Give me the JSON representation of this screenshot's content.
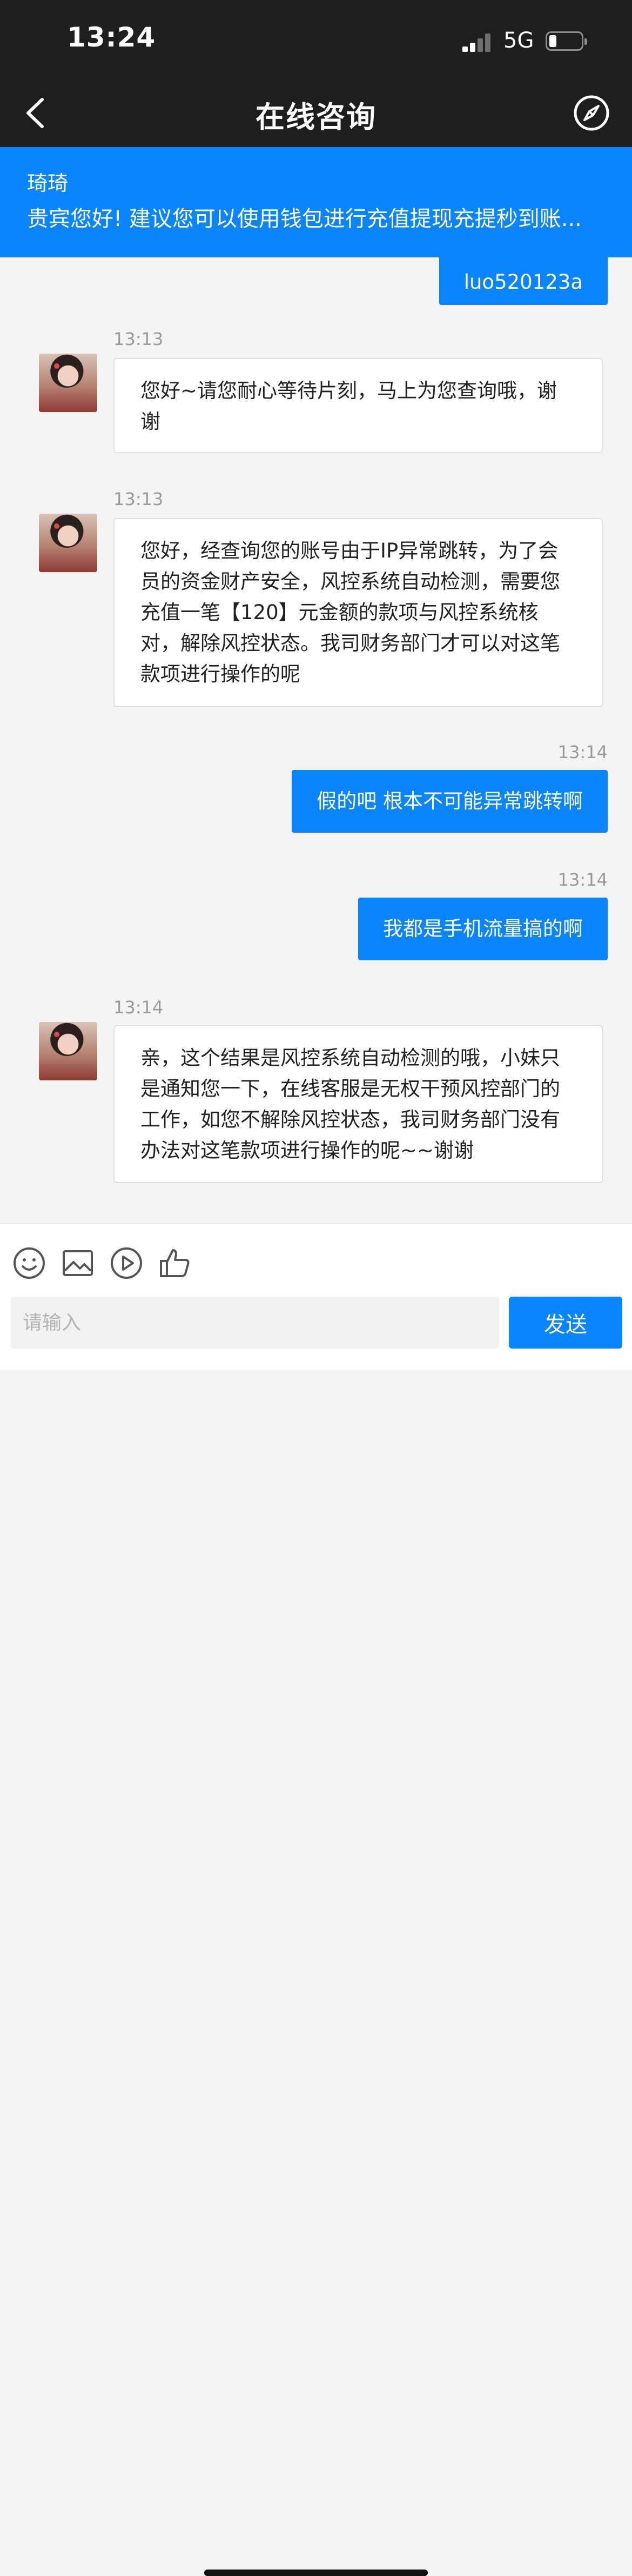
{
  "status": {
    "time": "13:24",
    "network": "5G"
  },
  "nav": {
    "title": "在线咨询"
  },
  "notice": {
    "name": "琦琦",
    "message": "贵宾您好! 建议您可以使用钱包进行充值提现充提秒到账..."
  },
  "messages": [
    {
      "side": "right",
      "text": "luo520123a"
    },
    {
      "side": "left",
      "time": "13:13",
      "text": "您好~请您耐心等待片刻，马上为您查询哦，谢谢"
    },
    {
      "side": "left",
      "time": "13:13",
      "text": "您好，经查询您的账号由于IP异常跳转，为了会员的资金财产安全，风控系统自动检测，需要您充值一笔【120】元金额的款项与风控系统核对，解除风控状态。我司财务部门才可以对这笔款项进行操作的呢"
    },
    {
      "side": "right",
      "time": "13:14",
      "text": "假的吧 根本不可能异常跳转啊"
    },
    {
      "side": "right",
      "time": "13:14",
      "text": "我都是手机流量搞的啊"
    },
    {
      "side": "left",
      "time": "13:14",
      "text": "亲，这个结果是风控系统自动检测的哦，小妹只是通知您一下，在线客服是无权干预风控部门的工作，如您不解除风控状态，我司财务部门没有办法对这笔款项进行操作的呢~~谢谢"
    }
  ],
  "input": {
    "placeholder": "请输入",
    "value": "",
    "send_label": "发送"
  },
  "icons": [
    "back-icon",
    "compass-icon",
    "emoji-icon",
    "image-icon",
    "video-icon",
    "like-icon"
  ],
  "colors": {
    "accent": "#0a84ff",
    "bar": "#1e1e1e",
    "background": "#f4f4f4"
  }
}
